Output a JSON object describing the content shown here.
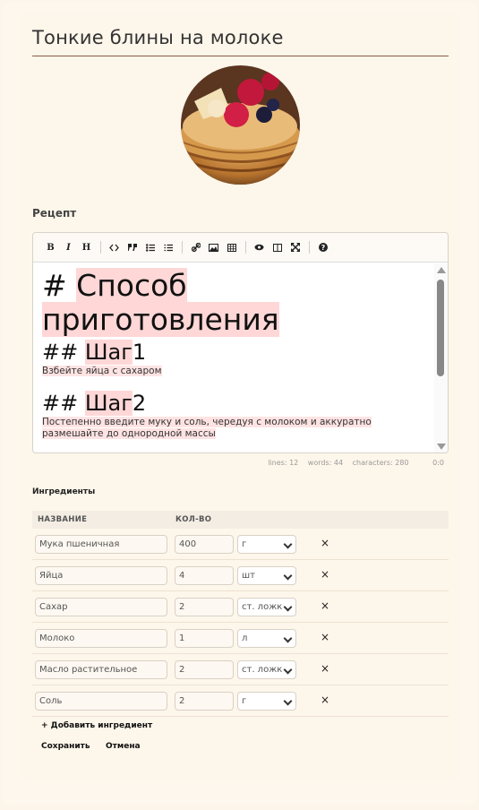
{
  "title": "Тонкие блины на молоке",
  "photo": {
    "alt": "pancakes with berries"
  },
  "recipe_label": "Рецепт",
  "toolbar": {
    "bold": "B",
    "italic": "I",
    "heading": "H",
    "icons": [
      "bold-icon",
      "italic-icon",
      "heading-icon",
      "code-icon",
      "quote-icon",
      "unordered-list-icon",
      "ordered-list-icon",
      "link-icon",
      "image-icon",
      "table-icon",
      "preview-icon",
      "side-by-side-icon",
      "fullscreen-icon",
      "help-icon"
    ]
  },
  "editor": {
    "h1_hash": "#",
    "h1_text_1": "Способ",
    "h1_text_2": "приготовления",
    "step1_hash": "##",
    "step1_word": "Шаг",
    "step1_num": "1",
    "step1_desc": "Взбейте яйца с сахаром",
    "step2_hash": "##",
    "step2_word": "Шаг",
    "step2_num": "2",
    "step2_desc_1": "Постепенно введите муку и соль, чередуя с молоком и аккуратно",
    "step2_desc_2": "размешайте до однородной массы"
  },
  "status": {
    "lines": "lines: 12",
    "words": "words: 44",
    "characters": "characters: 280",
    "cursor": "0:0"
  },
  "ingredients_label": "Ингредиенты",
  "table_headers": {
    "name": "НАЗВАНИЕ",
    "qty": "КОЛ-ВО"
  },
  "ingredients": [
    {
      "name": "Мука пшеничная",
      "qty": "400",
      "unit": "г"
    },
    {
      "name": "Яйца",
      "qty": "4",
      "unit": "шт"
    },
    {
      "name": "Сахар",
      "qty": "2",
      "unit": "ст. ложк"
    },
    {
      "name": "Молоко",
      "qty": "1",
      "unit": "л"
    },
    {
      "name": "Масло растительное",
      "qty": "2",
      "unit": "ст. ложк"
    },
    {
      "name": "Соль",
      "qty": "2",
      "unit": "г"
    }
  ],
  "delete_symbol": "×",
  "add_ingredient": "+ Добавить ингредиент",
  "save": "Сохранить",
  "cancel": "Отмена",
  "colors": {
    "accent_line": "#8a5a44",
    "highlight": "#ffd7d7",
    "background": "#fdf6ea"
  }
}
